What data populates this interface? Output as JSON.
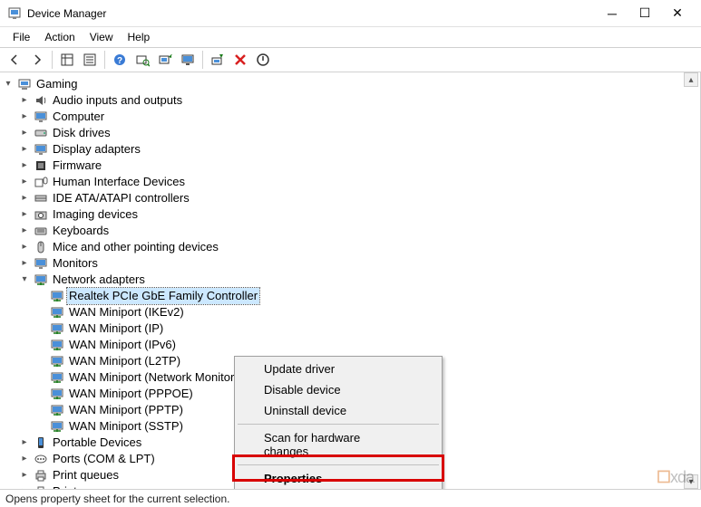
{
  "title": "Device Manager",
  "menu": {
    "file": "File",
    "action": "Action",
    "view": "View",
    "help": "Help"
  },
  "root": "Gaming",
  "categories": [
    {
      "name": "Audio inputs and outputs"
    },
    {
      "name": "Computer"
    },
    {
      "name": "Disk drives"
    },
    {
      "name": "Display adapters"
    },
    {
      "name": "Firmware"
    },
    {
      "name": "Human Interface Devices"
    },
    {
      "name": "IDE ATA/ATAPI controllers"
    },
    {
      "name": "Imaging devices"
    },
    {
      "name": "Keyboards"
    },
    {
      "name": "Mice and other pointing devices"
    },
    {
      "name": "Monitors"
    },
    {
      "name": "Network adapters",
      "expanded": true,
      "children": [
        {
          "name": "Realtek PCIe GbE Family Controller",
          "selected": true
        },
        {
          "name": "WAN Miniport (IKEv2)"
        },
        {
          "name": "WAN Miniport (IP)"
        },
        {
          "name": "WAN Miniport (IPv6)"
        },
        {
          "name": "WAN Miniport (L2TP)"
        },
        {
          "name": "WAN Miniport (Network Monitor)"
        },
        {
          "name": "WAN Miniport (PPPOE)"
        },
        {
          "name": "WAN Miniport (PPTP)"
        },
        {
          "name": "WAN Miniport (SSTP)"
        }
      ]
    },
    {
      "name": "Portable Devices"
    },
    {
      "name": "Ports (COM & LPT)"
    },
    {
      "name": "Print queues"
    },
    {
      "name": "Printers"
    }
  ],
  "context_menu": {
    "update": "Update driver",
    "disable": "Disable device",
    "uninstall": "Uninstall device",
    "scan": "Scan for hardware changes",
    "properties": "Properties"
  },
  "statusbar": "Opens property sheet for the current selection.",
  "watermark": {
    "prefix": "",
    "brand": "xda"
  }
}
